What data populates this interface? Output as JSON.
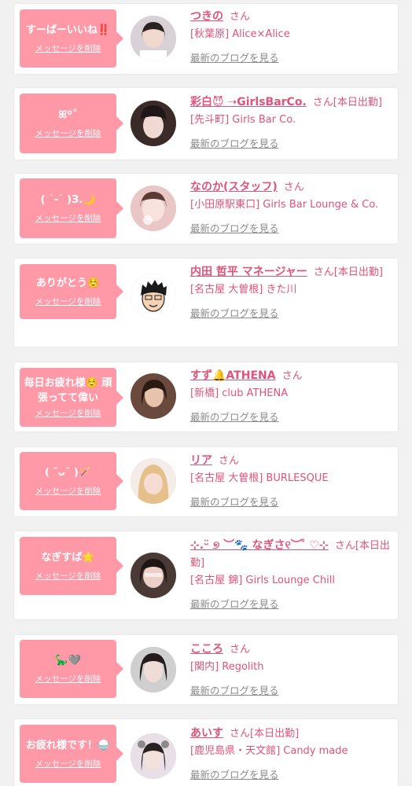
{
  "delete_label": "メッセージを削除",
  "honorific": "さん",
  "blog_label": "最新のブログを見る",
  "items": [
    {
      "message": "すーぱーいいね‼️",
      "name": "つきの",
      "status": "",
      "shop": "[秋葉原] Alice×Alice",
      "avatar_color": "#d8d2d6"
    },
    {
      "message": "ꕤ꙳˚",
      "name": "彩白😈 ➝GirlsBarCo.",
      "status": "[本日出勤]",
      "shop": "[先斗町] Girls Bar Co.",
      "avatar_color": "#3a2a28"
    },
    {
      "message": "( ˙-˙ )З.🌙",
      "name": "なのか(スタッフ)",
      "status": "",
      "shop": "[小田原駅東口] Girls Bar Lounge & Co.",
      "avatar_color": "#e9c7c6"
    },
    {
      "message": "ありがとう☺️",
      "name": "内田 哲平 マネージャー",
      "status": "[本日出勤]",
      "shop": "[名古屋 大曽根] きた川",
      "avatar_color": "#ffffff"
    },
    {
      "message": "毎日お疲れ様☺️ 頑張ってて偉い",
      "name": "すず🔔ATHENA",
      "status": "",
      "shop": "[新橋] club ATHENA",
      "avatar_color": "#6b4a3e"
    },
    {
      "message": "( ˘ᴗ˘ )🪄",
      "name": "リア",
      "status": "",
      "shop": "[名古屋 大曽根] BURLESQUE",
      "avatar_color": "#e6c08a"
    },
    {
      "message": "なぎすば🌟",
      "name": "⊹.ᵕ̈ ୭ ︶🐾 なぎさ୧︶ ̊ ♡⊹",
      "status": "[本日出勤]",
      "shop": "[名古屋 錦] Girls Lounge Chill",
      "avatar_color": "#4a3a36"
    },
    {
      "message": "🦕🩶",
      "name": "こころ",
      "status": "",
      "shop": "[関内] Regolith",
      "avatar_color": "#cfcfcf"
    },
    {
      "message": "お疲れ様です！🍚",
      "name": "あいす",
      "status": "[本日出勤]",
      "shop": "[鹿児島県・天文館] Candy made",
      "avatar_color": "#e8e0e6"
    }
  ]
}
